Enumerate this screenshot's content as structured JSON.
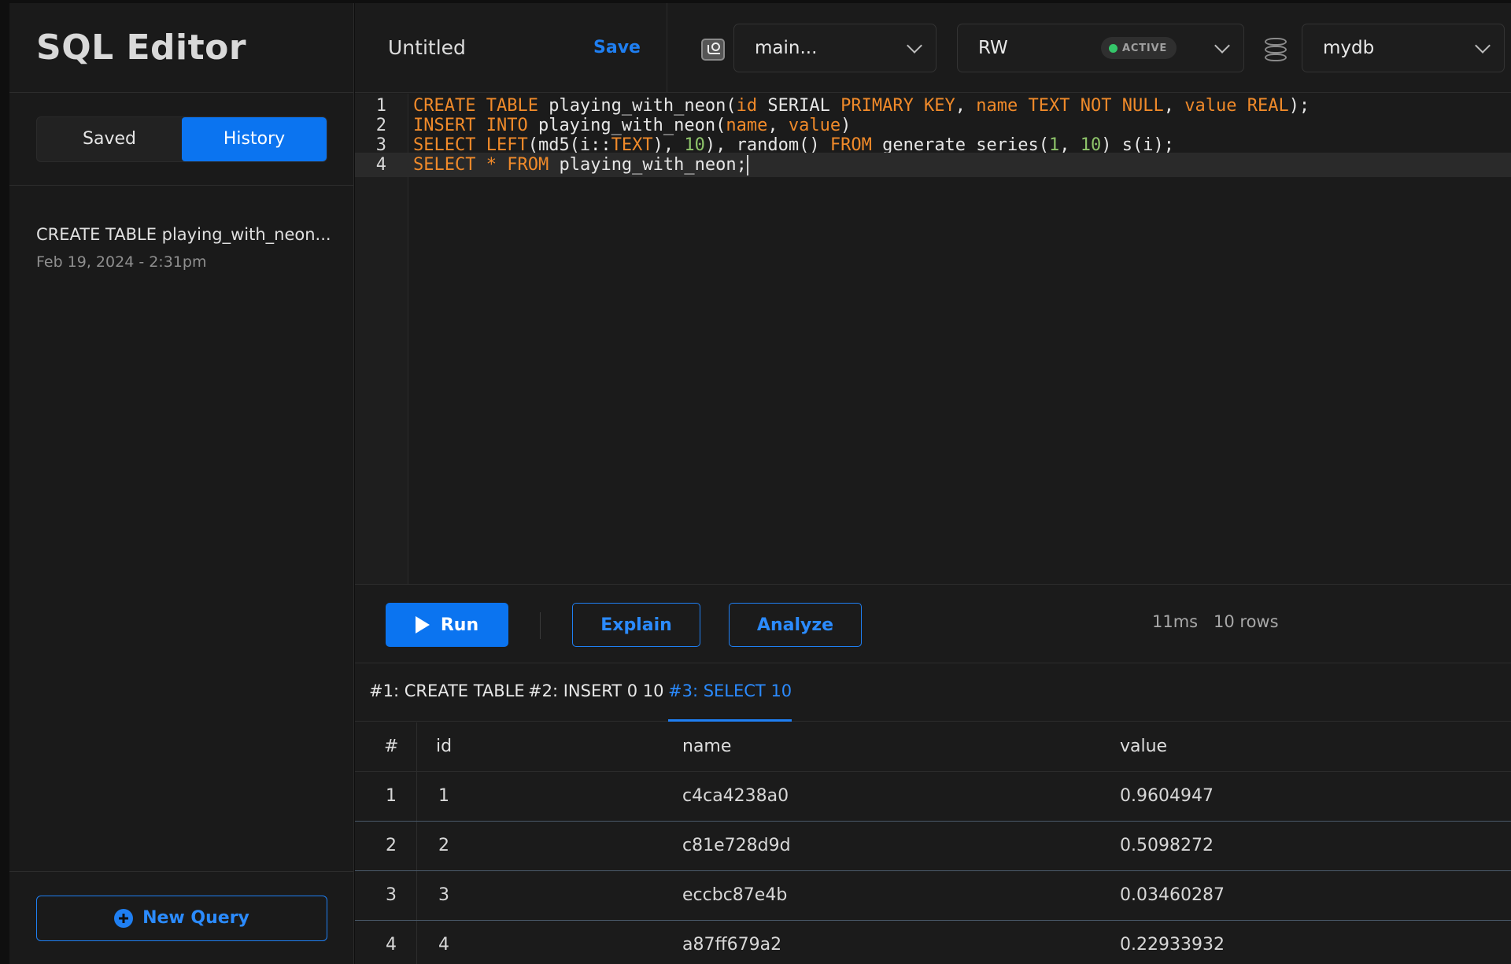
{
  "sidebar": {
    "title": "SQL Editor",
    "toggle": {
      "saved_label": "Saved",
      "history_label": "History",
      "active": "History"
    },
    "history": [
      {
        "title": "CREATE TABLE playing_with_neon...",
        "timestamp": "Feb 19, 2024 - 2:31pm"
      }
    ],
    "new_query_label": "New Query"
  },
  "topbar": {
    "doc_title": "Untitled",
    "save_label": "Save",
    "branch": {
      "icon": "branch-icon",
      "value": "main..."
    },
    "compute": {
      "value": "RW",
      "badge": "ACTIVE",
      "badge_color": "#35c66a"
    },
    "database": {
      "icon": "database-icon",
      "value": "mydb"
    }
  },
  "editor": {
    "current_line": 4,
    "lines": [
      "CREATE TABLE playing_with_neon(id SERIAL PRIMARY KEY, name TEXT NOT NULL, value REAL);",
      "INSERT INTO playing_with_neon(name, value)",
      "SELECT LEFT(md5(i::TEXT), 10), random() FROM generate_series(1, 10) s(i);",
      "SELECT * FROM playing_with_neon;"
    ]
  },
  "actions": {
    "run_label": "Run",
    "explain_label": "Explain",
    "analyze_label": "Analyze",
    "duration": "11ms",
    "row_count": "10 rows"
  },
  "results": {
    "tabs": [
      "#1: CREATE TABLE",
      "#2: INSERT 0 10",
      "#3: SELECT 10"
    ],
    "active_tab": 2,
    "columns": [
      "#",
      "id",
      "name",
      "value"
    ],
    "rows": [
      [
        "1",
        "1",
        "c4ca4238a0",
        "0.9604947"
      ],
      [
        "2",
        "2",
        "c81e728d9d",
        "0.5098272"
      ],
      [
        "3",
        "3",
        "eccbc87e4b",
        "0.03460287"
      ],
      [
        "4",
        "4",
        "a87ff679a2",
        "0.22933932"
      ]
    ]
  },
  "colors": {
    "accent": "#0b74f0",
    "keyword": "#f08a2a",
    "number": "#8ec46a"
  }
}
